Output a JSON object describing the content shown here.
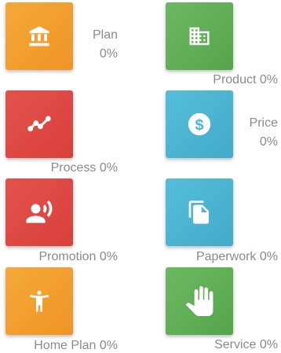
{
  "colors": {
    "orange": "#F29E2E",
    "green": "#5FAE55",
    "red": "#DF4A45",
    "blue": "#4BB6D3",
    "label": "#8a8a8a"
  },
  "tiles": {
    "plan": {
      "name": "Plan",
      "percent": "0%",
      "icon": "bank-icon",
      "color": "orange"
    },
    "product": {
      "name": "Product",
      "percent": "0%",
      "icon": "building-icon",
      "color": "green"
    },
    "process": {
      "name": "Process",
      "percent": "0%",
      "icon": "trending-line-icon",
      "color": "red"
    },
    "price": {
      "name": "Price",
      "percent": "0%",
      "icon": "dollar-coin-icon",
      "color": "blue"
    },
    "promotion": {
      "name": "Promotion",
      "percent": "0%",
      "icon": "person-speaking-icon",
      "color": "red"
    },
    "paperwork": {
      "name": "Paperwork",
      "percent": "0%",
      "icon": "documents-icon",
      "color": "blue"
    },
    "home_plan": {
      "name": "Home Plan",
      "percent": "0%",
      "icon": "person-arms-out-icon",
      "color": "orange"
    },
    "service": {
      "name": "Service",
      "percent": "0%",
      "icon": "hand-icon",
      "color": "green"
    }
  }
}
